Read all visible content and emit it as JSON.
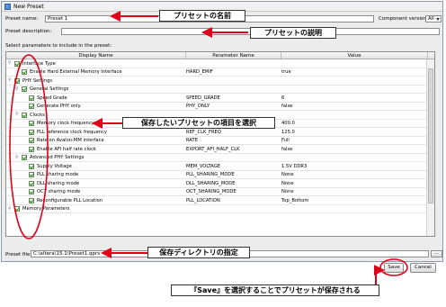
{
  "window": {
    "title": "New Preset"
  },
  "form": {
    "preset_name_label": "Preset name:",
    "preset_name_value": "Preset 1",
    "component_version_label": "Component version:",
    "component_version_value": "All",
    "preset_description_label": "Preset description:",
    "preset_description_value": "",
    "select_params_label": "Select parameters to include in the preset:",
    "preset_file_label": "Preset file:",
    "preset_file_value": "C:\\altera\\15.1\\Preset1.qprs",
    "browse_label": "..."
  },
  "table": {
    "columns": [
      "Display Name",
      "Parameter Name",
      "Value"
    ],
    "rows": [
      {
        "level": 0,
        "toggle": "⚲",
        "checked": true,
        "name": "Interface Type",
        "param": "",
        "value": ""
      },
      {
        "level": 1,
        "toggle": "",
        "checked": true,
        "name": "Enable Hard External Memory Interface",
        "param": "HARD_EMIF",
        "value": "true"
      },
      {
        "level": 0,
        "toggle": "⚲",
        "checked": true,
        "name": "PHY Settings",
        "param": "",
        "value": ""
      },
      {
        "level": 1,
        "toggle": "⚲",
        "checked": true,
        "name": "General Settings",
        "param": "",
        "value": ""
      },
      {
        "level": 2,
        "toggle": "",
        "checked": true,
        "name": "Speed Grade",
        "param": "SPEED_GRADE",
        "value": "6"
      },
      {
        "level": 2,
        "toggle": "",
        "checked": true,
        "name": "Generate PHY only",
        "param": "PHY_ONLY",
        "value": "false"
      },
      {
        "level": 1,
        "toggle": "⚲",
        "checked": true,
        "name": "Clocks",
        "param": "",
        "value": ""
      },
      {
        "level": 2,
        "toggle": "",
        "checked": true,
        "name": "Memory clock frequency",
        "param": "MEM_CLK_FREQ",
        "value": "400.0"
      },
      {
        "level": 2,
        "toggle": "",
        "checked": true,
        "name": "PLL reference clock frequency",
        "param": "REF_CLK_FREQ",
        "value": "125.0"
      },
      {
        "level": 2,
        "toggle": "",
        "checked": true,
        "name": "Rate on Avalon-MM interface",
        "param": "RATE",
        "value": "Full"
      },
      {
        "level": 2,
        "toggle": "",
        "checked": true,
        "name": "Enable AFI half rate clock",
        "param": "EXPORT_AFI_HALF_CLK",
        "value": "false"
      },
      {
        "level": 1,
        "toggle": "⚲",
        "checked": true,
        "name": "Advanced PHY Settings",
        "param": "",
        "value": ""
      },
      {
        "level": 2,
        "toggle": "",
        "checked": true,
        "name": "Supply Voltage",
        "param": "MEM_VOLTAGE",
        "value": "1.5V DDR3"
      },
      {
        "level": 2,
        "toggle": "",
        "checked": true,
        "name": "PLL sharing mode",
        "param": "PLL_SHARING_MODE",
        "value": "None"
      },
      {
        "level": 2,
        "toggle": "",
        "checked": true,
        "name": "DLL sharing mode",
        "param": "DLL_SHARING_MODE",
        "value": "None"
      },
      {
        "level": 2,
        "toggle": "",
        "checked": true,
        "name": "OCT sharing mode",
        "param": "OCT_SHARING_MODE",
        "value": "None"
      },
      {
        "level": 2,
        "toggle": "",
        "checked": true,
        "name": "Reconfigurable PLL Location",
        "param": "PLL_LOCATION",
        "value": "Top_Bottom"
      },
      {
        "level": 0,
        "toggle": "⚲",
        "checked": true,
        "name": "Memory Parameters",
        "param": "",
        "value": ""
      }
    ]
  },
  "buttons": {
    "save": "Save",
    "cancel": "Cancel"
  },
  "callouts": {
    "preset_name": "プリセットの名前",
    "preset_description": "プリセットの説明",
    "select_items": "保存したいプリセットの項目を選択",
    "save_directory": "保存ディレクトリの指定",
    "save_note": "『Save』を選択することでプリセットが保存される"
  },
  "colors": {
    "annotation": "#e0001a",
    "window_bg": "#ececec"
  }
}
